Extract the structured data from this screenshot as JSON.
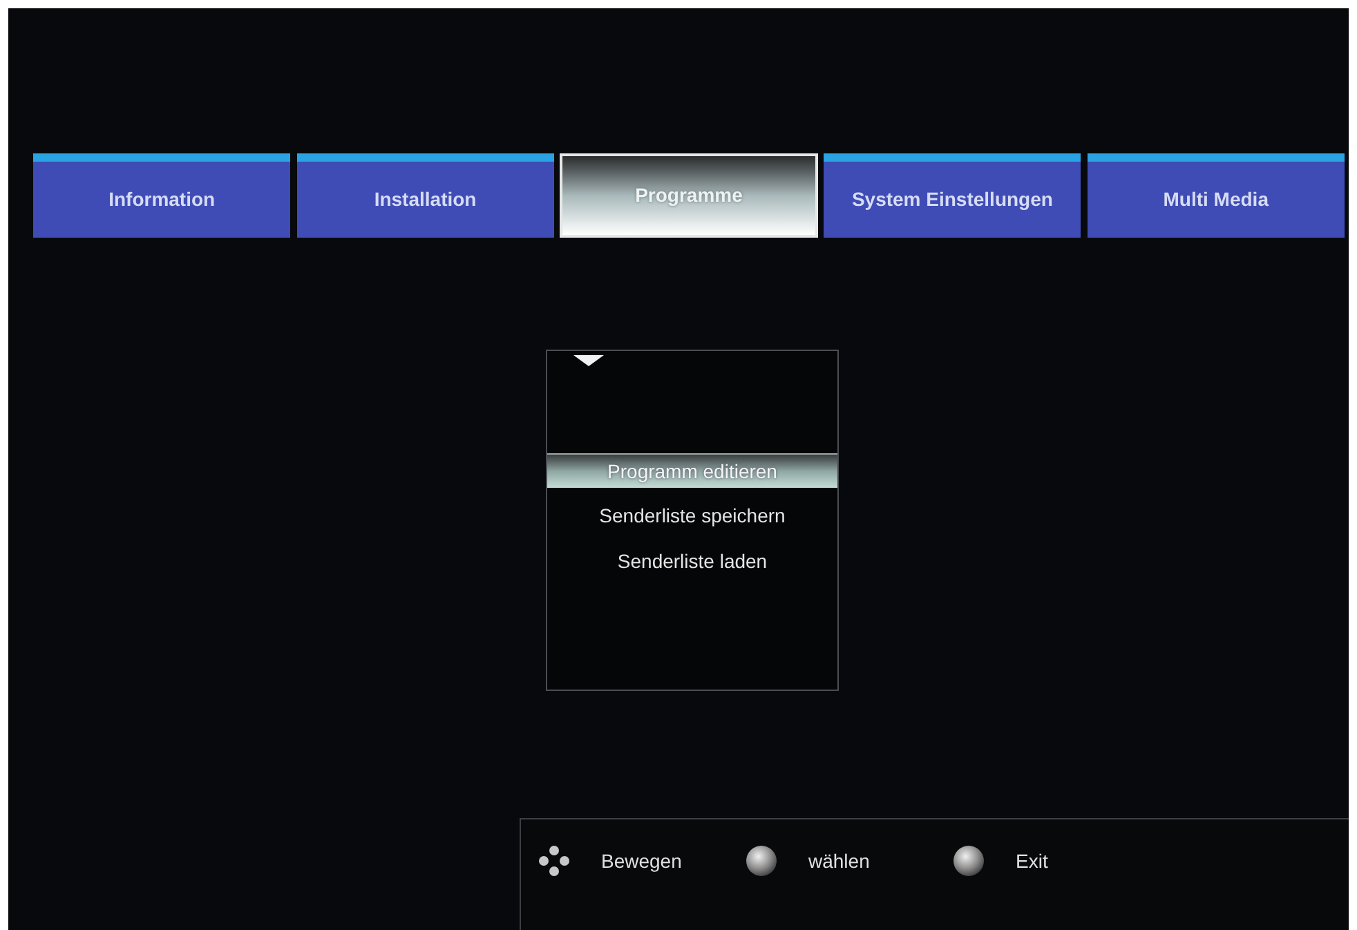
{
  "tabs": [
    {
      "label": "Information",
      "selected": false
    },
    {
      "label": "Installation",
      "selected": false
    },
    {
      "label": "Programme",
      "selected": true
    },
    {
      "label": "System Einstellungen",
      "selected": false
    },
    {
      "label": "Multi Media",
      "selected": false
    }
  ],
  "menu": {
    "items": [
      {
        "label": "Programm editieren",
        "selected": true
      },
      {
        "label": "Senderliste speichern",
        "selected": false
      },
      {
        "label": "Senderliste laden",
        "selected": false
      }
    ]
  },
  "footer": {
    "hints": [
      {
        "kind": "move",
        "label": "Bewegen"
      },
      {
        "kind": "ok",
        "label": "wählen"
      },
      {
        "kind": "exit",
        "label": "Exit"
      }
    ]
  }
}
